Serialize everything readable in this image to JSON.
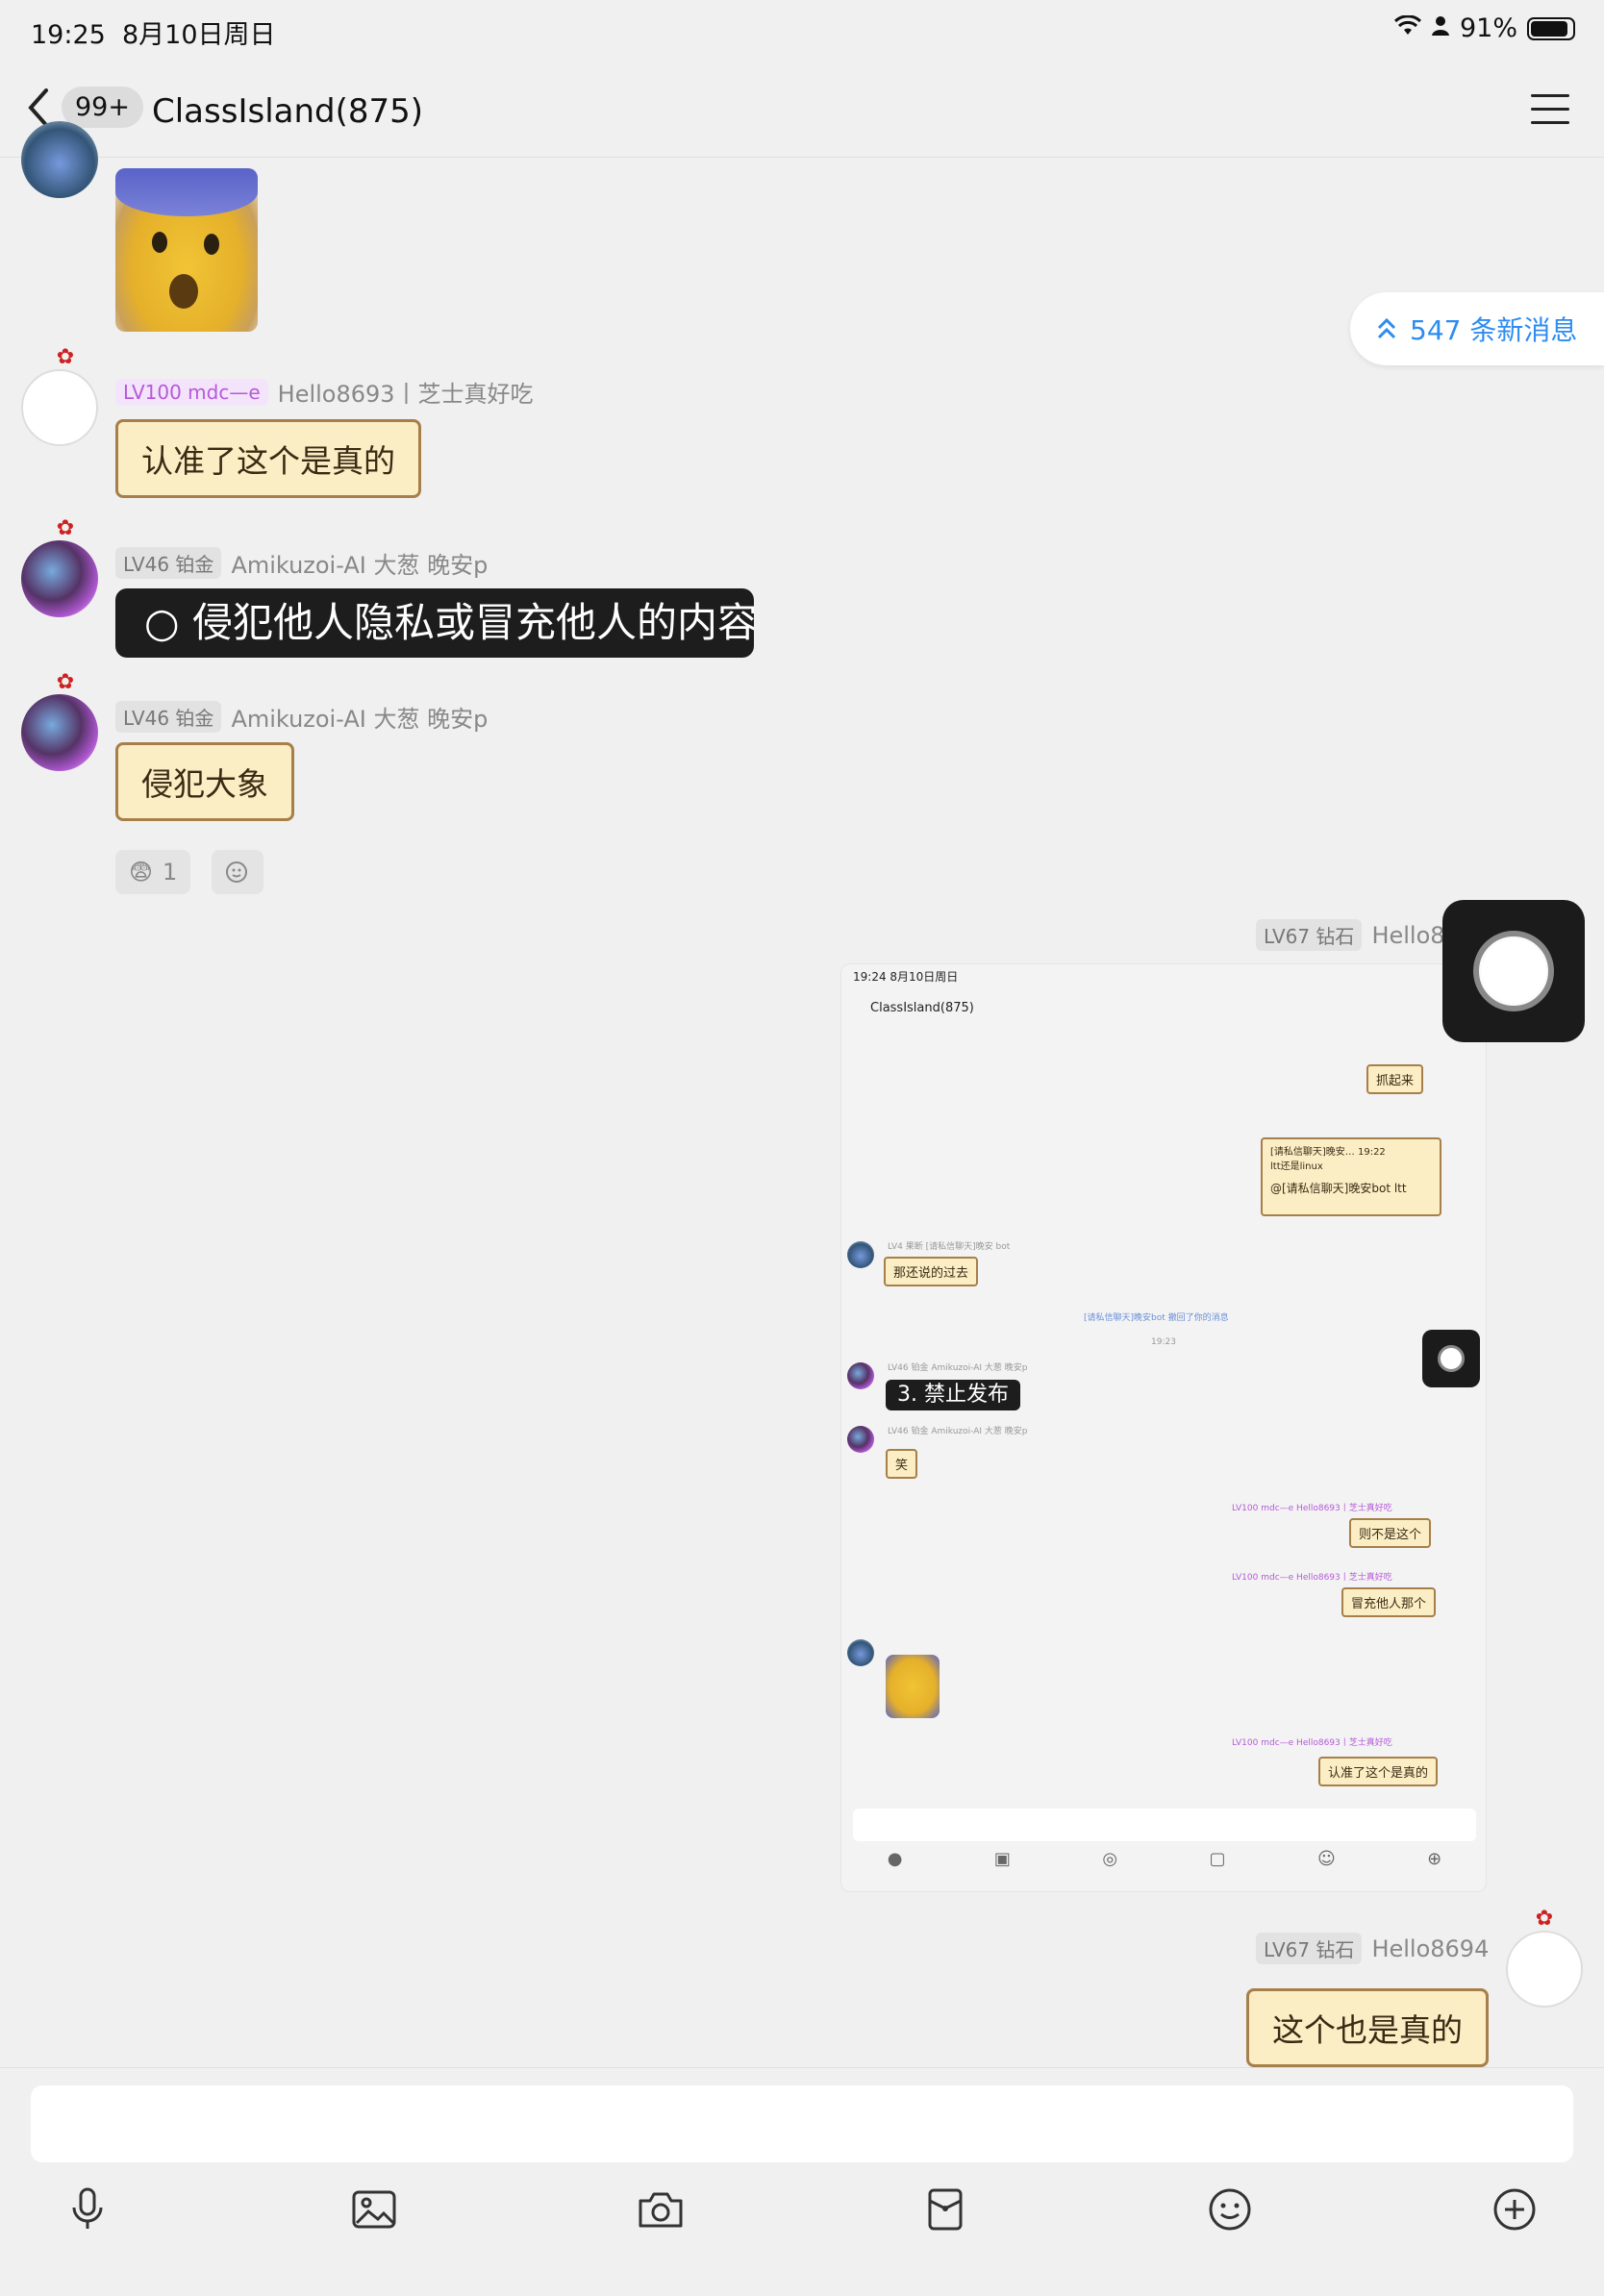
{
  "status": {
    "time": "19:25",
    "date": "8月10日周日",
    "battery": "91%"
  },
  "header": {
    "unread": "99+",
    "title": "ClassIsland(875)"
  },
  "new_messages": "547 条新消息",
  "messages": [
    {
      "level": "LV100 mdc—e",
      "name": "Hello8693丨芝士真好吃",
      "text": "认准了这个是真的"
    },
    {
      "level": "LV46 铂金",
      "name": "Amikuzoi-AI 大葱 晚安p",
      "text": "○  侵犯他人隐私或冒充他人的内容"
    },
    {
      "level": "LV46 铂金",
      "name": "Amikuzoi-AI 大葱 晚安p",
      "text": "侵犯大象"
    },
    {
      "level": "LV67 钻石",
      "name": "Hello8694",
      "text": "这个也是真的"
    }
  ],
  "reaction": {
    "emoji": "😨",
    "count": "1"
  },
  "shot": {
    "time": "19:24  8月10日周日",
    "title": "ClassIsland(875)",
    "bubble1": "抓起来",
    "quote_head": "[请私信聊天]晚安… 19:22",
    "quote_body": "ltt还是linux",
    "quote_reply": "@[请私信聊天]晚安bot ltt",
    "bot_name": "LV4 果断  [请私信聊天]晚安 bot",
    "bot_text": "那还说的过去",
    "recall": "[请私信聊天]晚安bot 撤回了你的消息",
    "time2": "19:23",
    "amik_name": "LV46 铂金  Amikuzoi-AI 大葱 晚安p",
    "dark_text": "3. 禁止发布",
    "amik_text": "笑",
    "h_name": "LV100 mdc—e  Hello8693丨芝士真好吃",
    "reply1": "则不是这个",
    "reply2": "冒充他人那个",
    "reply3": "认准了这个是真的"
  },
  "tools": [
    "mic-icon",
    "image-icon",
    "camera-icon",
    "red-packet-icon",
    "emoji-icon",
    "plus-icon"
  ]
}
